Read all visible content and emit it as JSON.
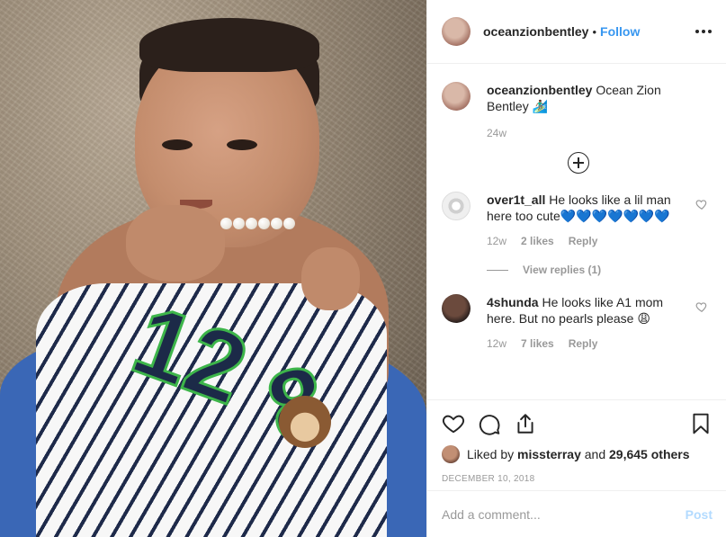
{
  "header": {
    "username": "oceanzionbentley",
    "separator": "•",
    "follow_label": "Follow"
  },
  "caption": {
    "username": "oceanzionbentley",
    "text": "Ocean Zion Bentley 🏄🏾‍♂️",
    "time": "24w"
  },
  "comments": [
    {
      "username": "over1t_all",
      "text": "He looks like a lil man here too cute💙💙💙💙💙💙💙",
      "time": "12w",
      "likes": "2 likes",
      "reply_label": "Reply",
      "view_replies": "View replies (1)"
    },
    {
      "username": "4shunda",
      "text": "He looks like A1 mom here. But no pearls please 😩",
      "time": "12w",
      "likes": "7 likes",
      "reply_label": "Reply"
    }
  ],
  "likes": {
    "prefix": "Liked by",
    "user": "missterray",
    "joiner": "and",
    "others": "29,645 others"
  },
  "post_date": "DECEMBER 10, 2018",
  "add_comment": {
    "placeholder": "Add a comment...",
    "post_label": "Post"
  },
  "photo": {
    "jersey_numbers": [
      "12",
      "8"
    ]
  },
  "colors": {
    "link_blue": "#3897f0",
    "post_disabled": "#b3dbff",
    "muted": "#999999",
    "text": "#262626"
  }
}
